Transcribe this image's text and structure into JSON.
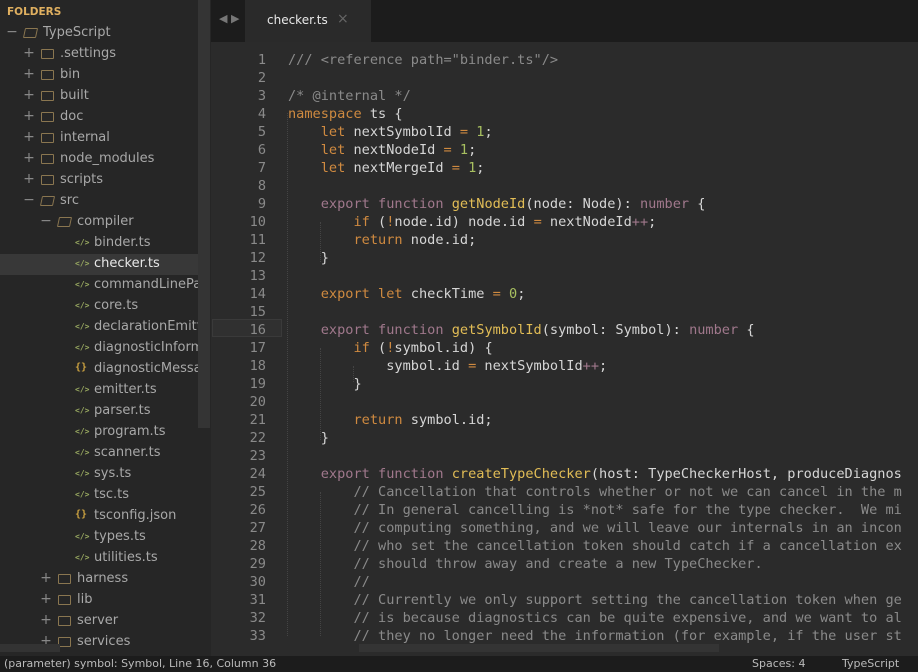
{
  "sidebar": {
    "title": "FOLDERS",
    "items": [
      {
        "label": "TypeScript",
        "type": "folder",
        "depth": 0,
        "open": true
      },
      {
        "label": ".settings",
        "type": "folder",
        "depth": 1,
        "open": false
      },
      {
        "label": "bin",
        "type": "folder",
        "depth": 1,
        "open": false
      },
      {
        "label": "built",
        "type": "folder",
        "depth": 1,
        "open": false
      },
      {
        "label": "doc",
        "type": "folder",
        "depth": 1,
        "open": false
      },
      {
        "label": "internal",
        "type": "folder",
        "depth": 1,
        "open": false
      },
      {
        "label": "node_modules",
        "type": "folder",
        "depth": 1,
        "open": false
      },
      {
        "label": "scripts",
        "type": "folder",
        "depth": 1,
        "open": false
      },
      {
        "label": "src",
        "type": "folder",
        "depth": 1,
        "open": true
      },
      {
        "label": "compiler",
        "type": "folder",
        "depth": 2,
        "open": true
      },
      {
        "label": "binder.ts",
        "type": "file",
        "depth": 3
      },
      {
        "label": "checker.ts",
        "type": "file",
        "depth": 3,
        "selected": true
      },
      {
        "label": "commandLineParser.ts",
        "type": "file",
        "depth": 3
      },
      {
        "label": "core.ts",
        "type": "file",
        "depth": 3
      },
      {
        "label": "declarationEmitter.ts",
        "type": "file",
        "depth": 3
      },
      {
        "label": "diagnosticInformationMap.generated.ts",
        "type": "file",
        "depth": 3
      },
      {
        "label": "diagnosticMessages.json",
        "type": "json",
        "depth": 3
      },
      {
        "label": "emitter.ts",
        "type": "file",
        "depth": 3
      },
      {
        "label": "parser.ts",
        "type": "file",
        "depth": 3
      },
      {
        "label": "program.ts",
        "type": "file",
        "depth": 3
      },
      {
        "label": "scanner.ts",
        "type": "file",
        "depth": 3
      },
      {
        "label": "sys.ts",
        "type": "file",
        "depth": 3
      },
      {
        "label": "tsc.ts",
        "type": "file",
        "depth": 3
      },
      {
        "label": "tsconfig.json",
        "type": "json",
        "depth": 3
      },
      {
        "label": "types.ts",
        "type": "file",
        "depth": 3
      },
      {
        "label": "utilities.ts",
        "type": "file",
        "depth": 3
      },
      {
        "label": "harness",
        "type": "folder",
        "depth": 2,
        "open": false
      },
      {
        "label": "lib",
        "type": "folder",
        "depth": 2,
        "open": false
      },
      {
        "label": "server",
        "type": "folder",
        "depth": 2,
        "open": false
      },
      {
        "label": "services",
        "type": "folder",
        "depth": 2,
        "open": false
      }
    ]
  },
  "tabs": [
    {
      "label": "checker.ts",
      "close_icon": "close-icon"
    }
  ],
  "nav_icons": [
    "arrow-left-icon",
    "arrow-right-icon"
  ],
  "editor": {
    "current_line": 16,
    "lines": [
      [
        [
          "c",
          "/// <reference path=\"binder.ts\"/>"
        ]
      ],
      [],
      [
        [
          "c",
          "/* @internal */"
        ]
      ],
      [
        [
          "k",
          "namespace"
        ],
        [
          "t",
          " ts {"
        ]
      ],
      [
        [
          "t",
          "    "
        ],
        [
          "k",
          "let"
        ],
        [
          "t",
          " nextSymbolId "
        ],
        [
          "o",
          "="
        ],
        [
          "t",
          " "
        ],
        [
          "n",
          "1"
        ],
        [
          "t",
          ";"
        ]
      ],
      [
        [
          "t",
          "    "
        ],
        [
          "k",
          "let"
        ],
        [
          "t",
          " nextNodeId "
        ],
        [
          "o",
          "="
        ],
        [
          "t",
          " "
        ],
        [
          "n",
          "1"
        ],
        [
          "t",
          ";"
        ]
      ],
      [
        [
          "t",
          "    "
        ],
        [
          "k",
          "let"
        ],
        [
          "t",
          " nextMergeId "
        ],
        [
          "o",
          "="
        ],
        [
          "t",
          " "
        ],
        [
          "n",
          "1"
        ],
        [
          "t",
          ";"
        ]
      ],
      [],
      [
        [
          "t",
          "    "
        ],
        [
          "m",
          "export function"
        ],
        [
          "t",
          " "
        ],
        [
          "f",
          "getNodeId"
        ],
        [
          "t",
          "(node: Node): "
        ],
        [
          "p",
          "number"
        ],
        [
          "t",
          " {"
        ]
      ],
      [
        [
          "t",
          "        "
        ],
        [
          "k",
          "if"
        ],
        [
          "t",
          " ("
        ],
        [
          "o",
          "!"
        ],
        [
          "t",
          "node.id) node.id "
        ],
        [
          "o",
          "="
        ],
        [
          "t",
          " nextNodeId"
        ],
        [
          "p",
          "++"
        ],
        [
          "t",
          ";"
        ]
      ],
      [
        [
          "t",
          "        "
        ],
        [
          "k",
          "return"
        ],
        [
          "t",
          " node.id;"
        ]
      ],
      [
        [
          "t",
          "    }"
        ]
      ],
      [],
      [
        [
          "t",
          "    "
        ],
        [
          "k",
          "export let"
        ],
        [
          "t",
          " checkTime "
        ],
        [
          "o",
          "="
        ],
        [
          "t",
          " "
        ],
        [
          "n",
          "0"
        ],
        [
          "t",
          ";"
        ]
      ],
      [],
      [
        [
          "t",
          "    "
        ],
        [
          "m",
          "export function"
        ],
        [
          "t",
          " "
        ],
        [
          "f",
          "getSymbolId"
        ],
        [
          "t",
          "(symbol: Symbol): "
        ],
        [
          "p",
          "number"
        ],
        [
          "t",
          " {"
        ]
      ],
      [
        [
          "t",
          "        "
        ],
        [
          "k",
          "if"
        ],
        [
          "t",
          " ("
        ],
        [
          "o",
          "!"
        ],
        [
          "t",
          "symbol.id) {"
        ]
      ],
      [
        [
          "t",
          "            symbol.id "
        ],
        [
          "o",
          "="
        ],
        [
          "t",
          " nextSymbolId"
        ],
        [
          "p",
          "++"
        ],
        [
          "t",
          ";"
        ]
      ],
      [
        [
          "t",
          "        }"
        ]
      ],
      [],
      [
        [
          "t",
          "        "
        ],
        [
          "k",
          "return"
        ],
        [
          "t",
          " symbol.id;"
        ]
      ],
      [
        [
          "t",
          "    }"
        ]
      ],
      [],
      [
        [
          "t",
          "    "
        ],
        [
          "m",
          "export function"
        ],
        [
          "t",
          " "
        ],
        [
          "f",
          "createTypeChecker"
        ],
        [
          "t",
          "(host: TypeCheckerHost, produceDiagnos"
        ]
      ],
      [
        [
          "c",
          "        // Cancellation that controls whether or not we can cancel in the m"
        ]
      ],
      [
        [
          "c",
          "        // In general cancelling is *not* safe for the type checker.  We mi"
        ]
      ],
      [
        [
          "c",
          "        // computing something, and we will leave our internals in an incon"
        ]
      ],
      [
        [
          "c",
          "        // who set the cancellation token should catch if a cancellation ex"
        ]
      ],
      [
        [
          "c",
          "        // should throw away and create a new TypeChecker."
        ]
      ],
      [
        [
          "c",
          "        //"
        ]
      ],
      [
        [
          "c",
          "        // Currently we only support setting the cancellation token when ge"
        ]
      ],
      [
        [
          "c",
          "        // is because diagnostics can be quite expensive, and we want to al"
        ]
      ],
      [
        [
          "c",
          "        // they no longer need the information (for example, if the user st"
        ]
      ]
    ]
  },
  "status": {
    "left": "(parameter) symbol: Symbol, Line 16, Column 36",
    "spaces": "Spaces: 4",
    "language": "TypeScript"
  }
}
